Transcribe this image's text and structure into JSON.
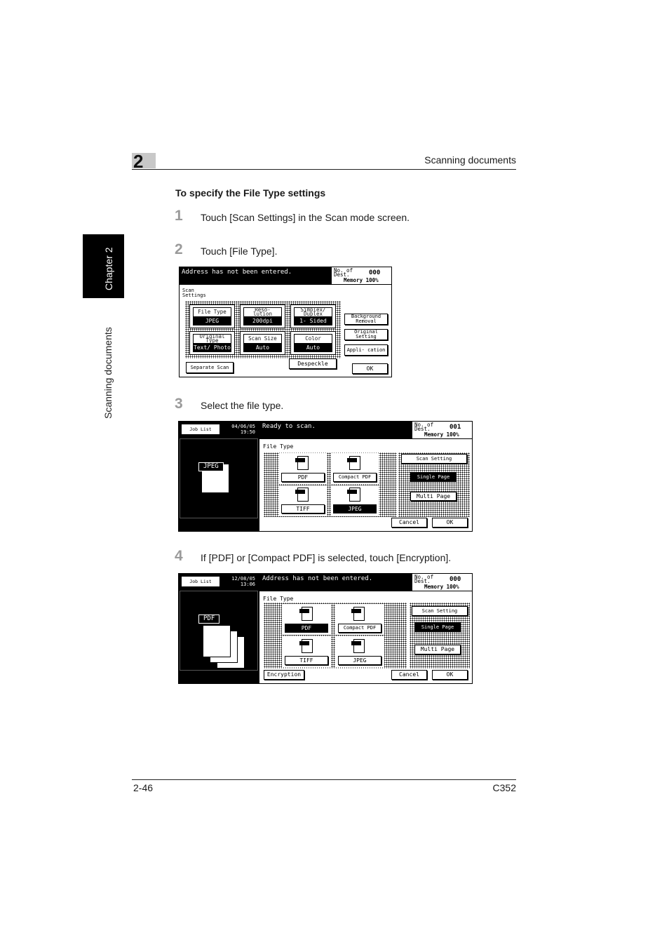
{
  "header": {
    "chapter_number": "2",
    "running_title": "Scanning documents"
  },
  "side_tab": {
    "chapter": "Chapter 2",
    "section": "Scanning documents"
  },
  "heading": "To specify the File Type settings",
  "steps": [
    {
      "num": "1",
      "text": "Touch [Scan Settings] in the Scan mode screen."
    },
    {
      "num": "2",
      "text": "Touch [File Type]."
    },
    {
      "num": "3",
      "text": "Select the file type."
    },
    {
      "num": "4",
      "text": "If [PDF] or [Compact PDF] is selected, touch [Encryption]."
    }
  ],
  "screen1": {
    "message": "Address has not been entered.",
    "dest_label": "No. of Dest.",
    "dest_count": "000",
    "memory": "Memory 100%",
    "group_label": "Scan Settings",
    "tiles": [
      {
        "label": "File Type",
        "value": "JPEG"
      },
      {
        "label": "Reso- lution",
        "value": "200dpi"
      },
      {
        "label": "Simplex/ Duplex",
        "value": "1- Sided"
      },
      {
        "label": "Original Type",
        "value": "Text/ Photo"
      },
      {
        "label": "Scan Size",
        "value": "Auto"
      },
      {
        "label": "Color",
        "value": "Auto"
      }
    ],
    "side_buttons": [
      "Background Removal",
      "Original Setting",
      "Appli- cation"
    ],
    "separate_scan": "Separate Scan",
    "despeckle": "Despeckle",
    "ok": "OK"
  },
  "screen2": {
    "job_list": "Job List",
    "date": "04/06/05",
    "time": "19:50",
    "message": "Ready to scan.",
    "dest_label": "No. of Dest.",
    "dest_count": "001",
    "memory": "Memory 100%",
    "preview_tag": "JPEG",
    "title": "File Type",
    "types": [
      "PDF",
      "Compact PDF",
      "TIFF",
      "JPEG"
    ],
    "selected_type": "JPEG",
    "scan_setting": "Scan Setting",
    "single_page": "Single Page",
    "multi_page": "Multi Page",
    "cancel": "Cancel",
    "ok": "OK"
  },
  "screen3": {
    "job_list": "Job List",
    "date": "12/08/05",
    "time": "13:06",
    "message": "Address has not been entered.",
    "dest_label": "No. of Dest.",
    "dest_count": "000",
    "memory": "Memory 100%",
    "preview_tag": "PDF",
    "title": "File Type",
    "types": [
      "PDF",
      "Compact PDF",
      "TIFF",
      "JPEG"
    ],
    "selected_type": "PDF",
    "scan_setting": "Scan Setting",
    "single_page": "Single Page",
    "multi_page": "Multi Page",
    "encryption": "Encryption",
    "cancel": "Cancel",
    "ok": "OK"
  },
  "footer": {
    "page_number": "2-46",
    "model": "C352"
  }
}
